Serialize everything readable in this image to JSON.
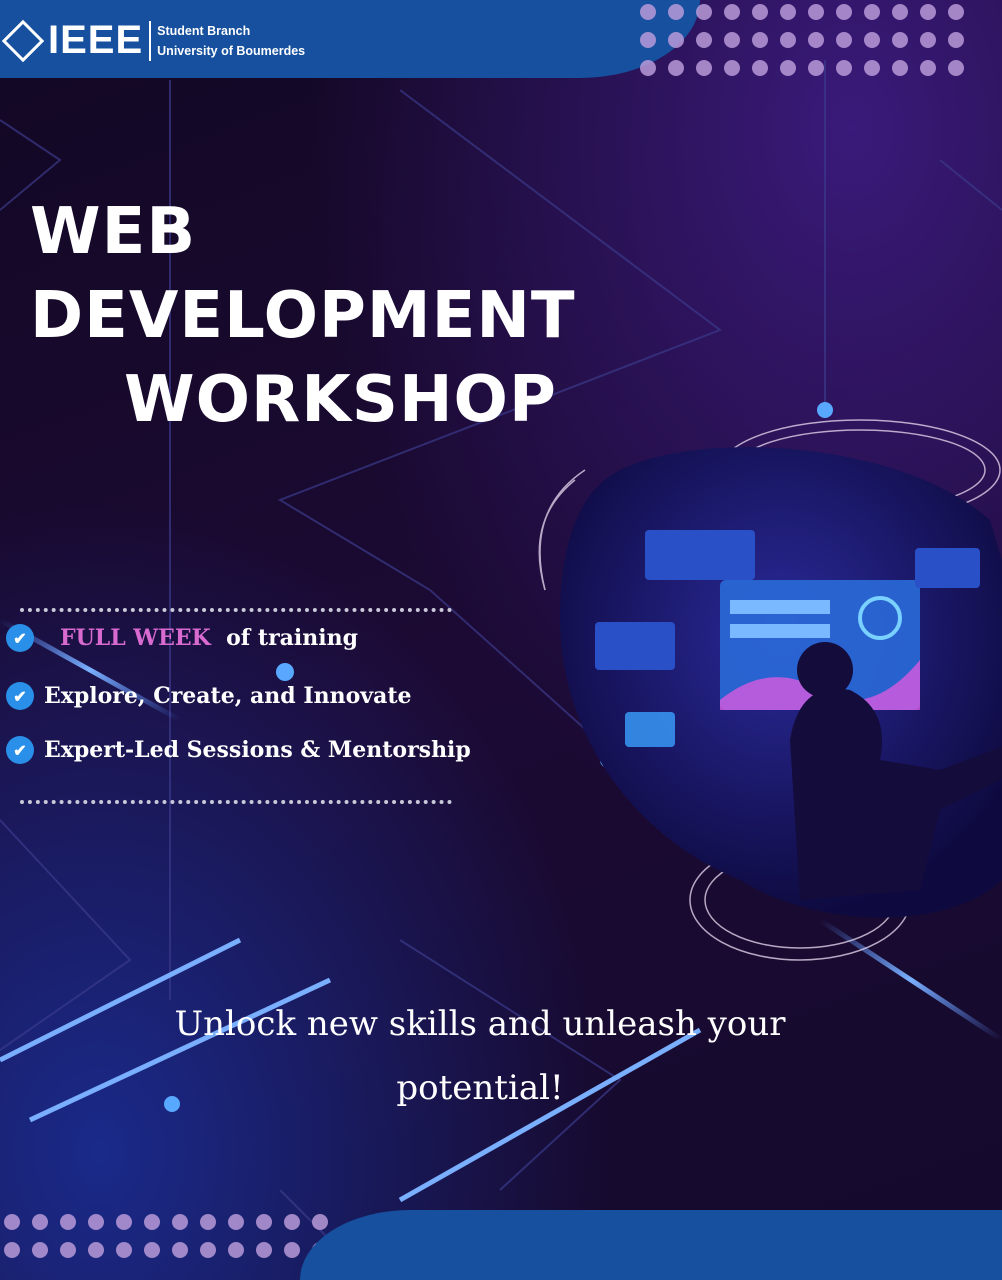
{
  "header": {
    "logo_text": "IEEE",
    "branch_line1": "Student Branch",
    "branch_line2": "University of Boumerdes"
  },
  "title": {
    "line1": "WEB",
    "line2": "DEVELOPMENT",
    "line3": "WORKSHOP"
  },
  "features": [
    {
      "highlight": "FULL WEEK",
      "text": "of  training",
      "icon": "check-circle-icon"
    },
    {
      "text": "Explore, Create, and Innovate",
      "icon": "check-circle-icon"
    },
    {
      "text": "Expert-Led Sessions & Mentorship",
      "icon": "check-circle-icon"
    }
  ],
  "tagline": {
    "line1": "Unlock new skills and unleash your",
    "line2": "potential!"
  },
  "colors": {
    "brand_blue": "#16509e",
    "highlight_pink": "#d86ad0",
    "check_blue": "#2a8fe8"
  }
}
